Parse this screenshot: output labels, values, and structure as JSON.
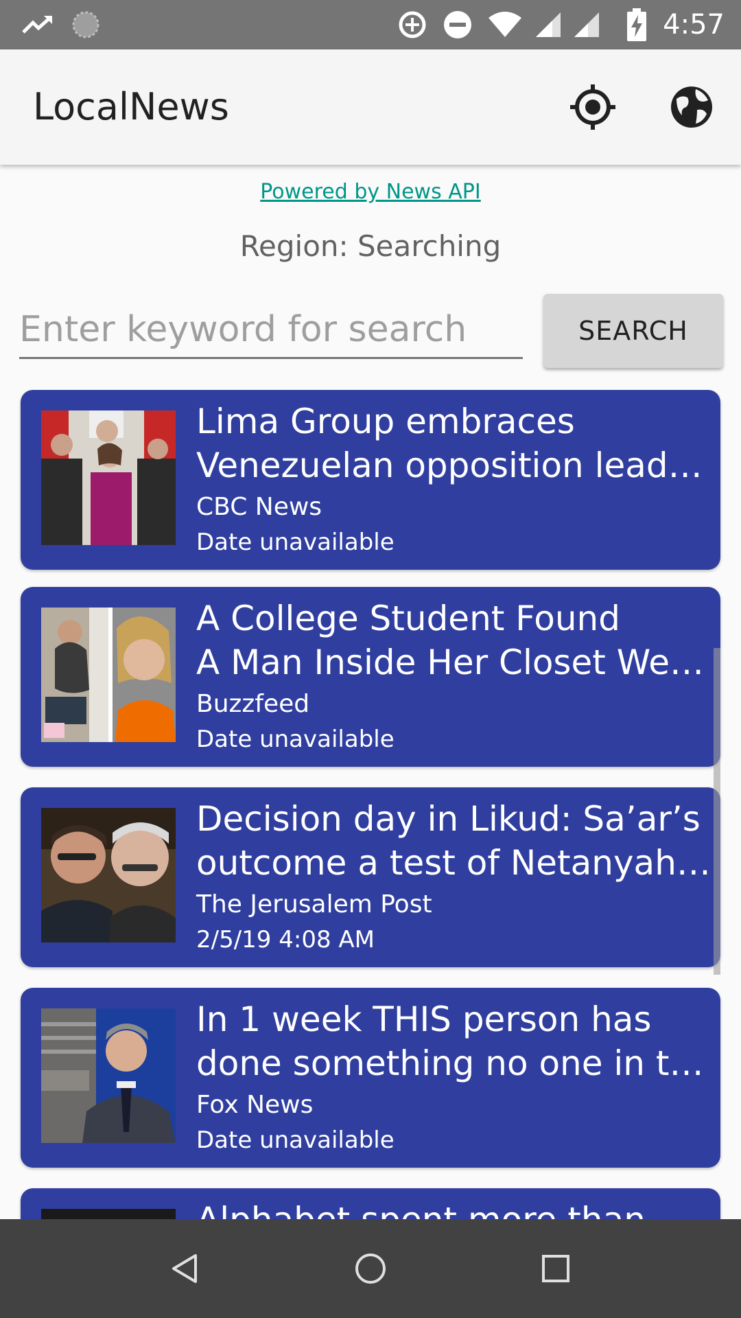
{
  "status_bar": {
    "time": "4:57",
    "icons": [
      "trending-icon",
      "sync-icon",
      "data-saver-icon",
      "do-not-disturb-icon",
      "wifi-icon",
      "signal-icon",
      "signal-icon",
      "battery-charging-icon"
    ]
  },
  "app_bar": {
    "title": "LocalNews",
    "actions": [
      "my-location-icon",
      "globe-icon"
    ]
  },
  "powered_by": "Powered by News API",
  "region_text": "Region: Searching",
  "search": {
    "placeholder": "Enter keyword for search",
    "value": "",
    "button_label": "SEARCH"
  },
  "articles": [
    {
      "title_lines": [
        "Lima Group embraces",
        "Venezuelan opposition leade…"
      ],
      "source": "CBC News",
      "date": "Date unavailable"
    },
    {
      "title_lines": [
        "A College Student Found",
        "A Man Inside Her Closet Wea…"
      ],
      "source": "Buzzfeed",
      "date": "Date unavailable"
    },
    {
      "title_lines": [
        "Decision day in Likud: Sa’ar’s",
        "outcome a test of Netanyahu…"
      ],
      "source": "The Jerusalem Post",
      "date": "2/5/19 4:08 AM"
    },
    {
      "title_lines": [
        "In 1 week THIS person has",
        "done something no one in th…"
      ],
      "source": "Fox News",
      "date": "Date unavailable"
    },
    {
      "title_lines": [
        "Alphabet spent more than",
        ""
      ],
      "source": "",
      "date": ""
    }
  ],
  "nav_bar": [
    "back-icon",
    "home-icon",
    "recents-icon"
  ],
  "colors": {
    "card": "#303f9f",
    "link": "#009688",
    "status_bar": "#757575",
    "nav_bar": "#424242"
  }
}
